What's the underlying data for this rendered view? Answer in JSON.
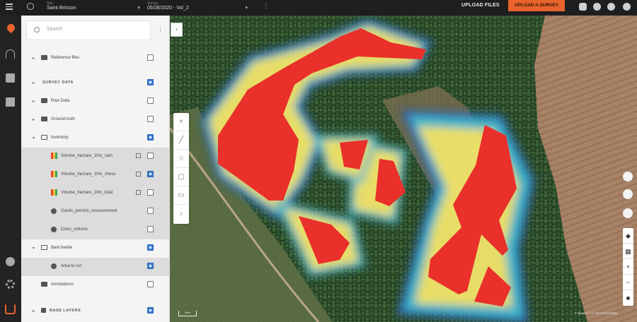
{
  "topbar": {
    "site_label": "Site",
    "site_value": "Saint Brisson",
    "survey_label": "Survey",
    "survey_value": "05/28/2020 - Vol_2",
    "upload_files": "UPLOAD FILES",
    "upload_survey": "UPLOAD A SURVEY"
  },
  "panel": {
    "search_placeholder": "Search",
    "items": [
      {
        "label": "Reference files"
      },
      {
        "label": "SURVEY DATA"
      },
      {
        "label": "Raw Data"
      },
      {
        "label": "Ground truth"
      },
      {
        "label": "Inventory"
      },
      {
        "label": "Volume_hectare_10m_cam"
      },
      {
        "label": "Volume_hectare_10m_zhoss"
      },
      {
        "label": "Volume_hectare_10m_total"
      },
      {
        "label": "Gaulis_perchis_recouvrement"
      },
      {
        "label": "Class_volume"
      },
      {
        "label": "Bark beetle"
      },
      {
        "label": "Area to cut"
      },
      {
        "label": "Annotations"
      },
      {
        "label": "BASE LAYERS"
      }
    ]
  },
  "map": {
    "attribution": "© Mapbox | © OpenStreetMap",
    "scale": "50m"
  },
  "colors": {
    "accent": "#e8632d",
    "hotspot": "#e9302a",
    "checkbox_on": "#3b7dd8"
  }
}
